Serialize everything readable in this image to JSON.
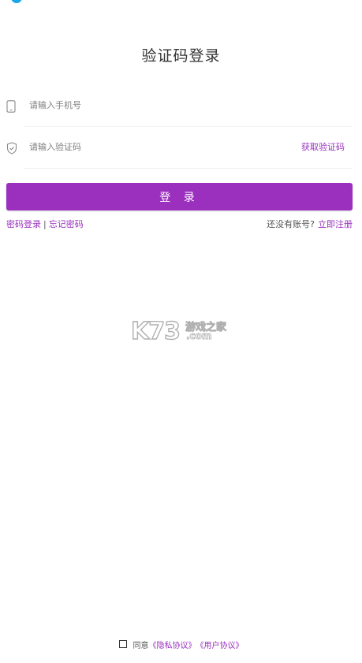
{
  "page": {
    "title": "验证码登录"
  },
  "phone_field": {
    "placeholder": "请输入手机号",
    "icon": "phone-icon"
  },
  "code_field": {
    "placeholder": "请输入验证码",
    "icon": "shield-icon",
    "get_code_label": "获取验证码"
  },
  "login_button": {
    "label": "登 录"
  },
  "links": {
    "password_login": "密码登录",
    "separator": "|",
    "forgot_password": "忘记密码",
    "no_account": "还没有账号?",
    "register": "立即注册"
  },
  "watermark": {
    "brand": "K73",
    "cn_text": "游戏之家",
    "domain": ".com"
  },
  "agreement": {
    "prefix": "同意",
    "privacy": "《隐私协议》",
    "user": "《用户协议》",
    "checked": false
  },
  "colors": {
    "accent": "#9b30be",
    "top_mark": "#1aa7e6"
  }
}
